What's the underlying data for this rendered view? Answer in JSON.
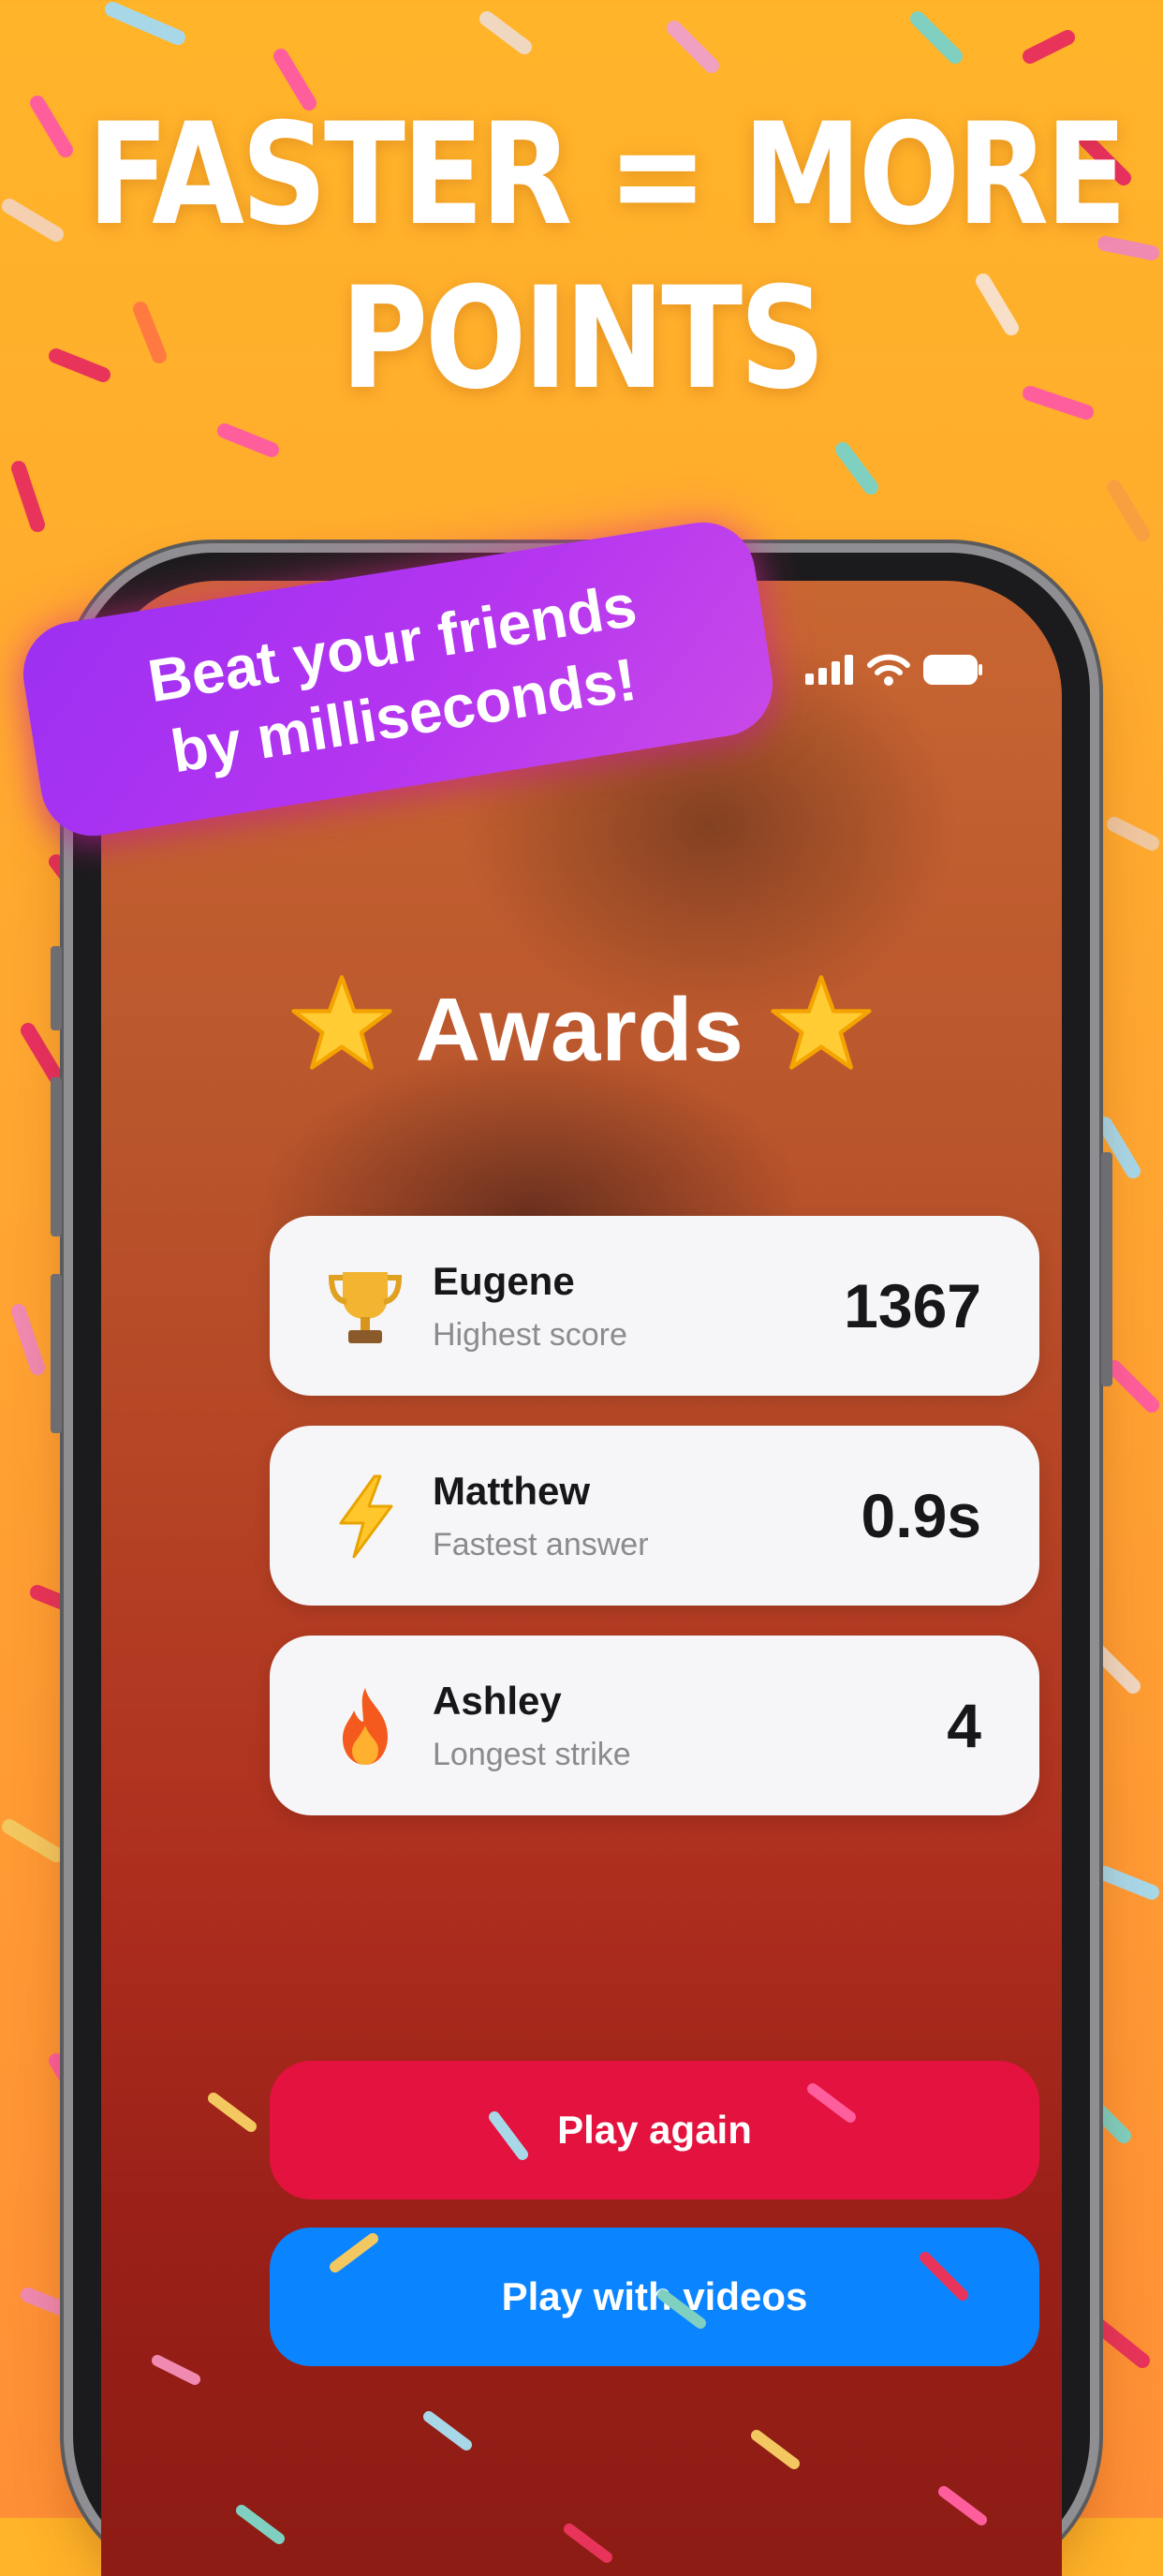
{
  "headline": {
    "line1": "FASTER = MORE",
    "line2": "POINTS"
  },
  "banner": {
    "line1": "Beat your friends",
    "line2": "by milliseconds!"
  },
  "screen": {
    "title": "Awards",
    "title_emoji": "star-icon",
    "awards": [
      {
        "icon": "trophy-icon",
        "name": "Eugene",
        "caption": "Highest score",
        "value": "1367"
      },
      {
        "icon": "lightning-icon",
        "name": "Matthew",
        "caption": "Fastest answer",
        "value": "0.9s"
      },
      {
        "icon": "fire-icon",
        "name": "Ashley",
        "caption": "Longest strike",
        "value": "4"
      }
    ],
    "buttons": {
      "play_again": "Play again",
      "play_with_videos": "Play with videos"
    }
  },
  "colors": {
    "background": "#FFA631",
    "banner": "#A933F2",
    "play_again": "#E3123E",
    "play_with_videos": "#0A84FF"
  }
}
